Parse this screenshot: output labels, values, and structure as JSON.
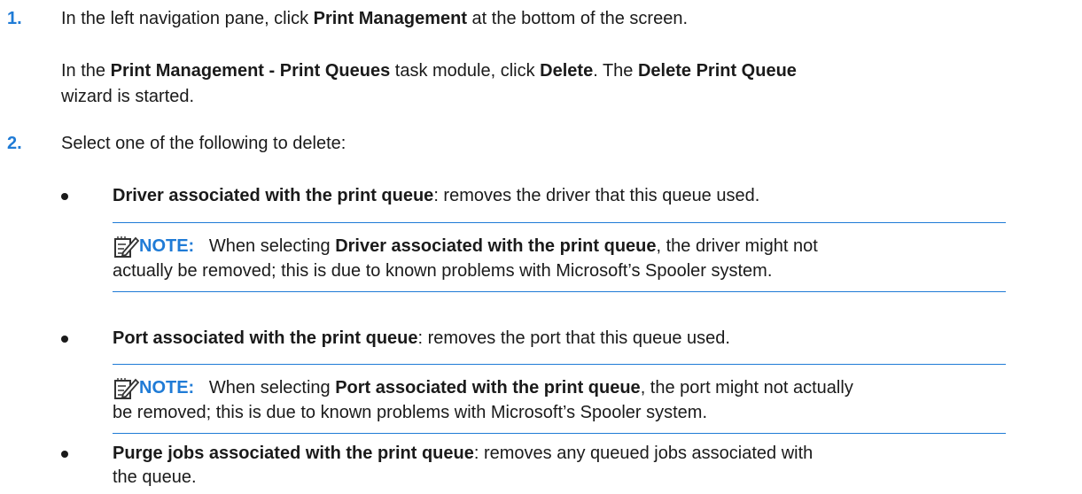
{
  "steps": [
    {
      "number": "1.",
      "line1": {
        "pre": "In the left navigation pane, click ",
        "b1": "Print Management",
        "post": " at the bottom of the screen."
      },
      "line2": {
        "pre": "In the ",
        "b1": "Print Management - Print Queues",
        "mid": " task module, click ",
        "b2": "Delete",
        "mid2": ". The ",
        "b3": "Delete Print Queue"
      },
      "line3": "wizard is started."
    },
    {
      "number": "2.",
      "intro": "Select one of the following to delete:",
      "bullets": [
        {
          "term": "Driver associated with the print queue",
          "desc": ": removes the driver that this queue used.",
          "note": {
            "label": "NOTE:",
            "pre": "When selecting ",
            "b": "Driver associated with the print queue",
            "post": ", the driver might not",
            "line2": "actually be removed; this is due to known problems with Microsoft’s Spooler system."
          }
        },
        {
          "term": "Port associated with the print queue",
          "desc": ": removes the port that this queue used.",
          "note": {
            "label": "NOTE:",
            "pre": "When selecting ",
            "b": "Port associated with the print queue",
            "post": ", the port might not actually",
            "line2": "be removed; this is due to known problems with Microsoft’s Spooler system."
          }
        },
        {
          "term": "Purge jobs associated with the print queue",
          "desc": ": removes any queued jobs associated with",
          "line2": "the queue."
        }
      ]
    }
  ],
  "colors": {
    "accent": "#1f7bd6",
    "text": "#1a1a1a"
  }
}
